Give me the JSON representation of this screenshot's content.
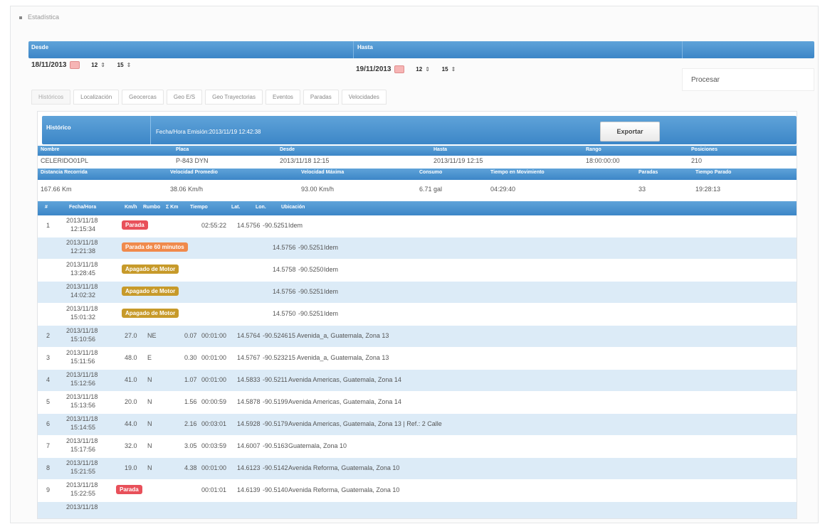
{
  "section_title": "Estadística",
  "range": {
    "desde_label": "Desde",
    "hasta_label": "Hasta",
    "desde_date": "18/11/2013",
    "desde_hour": "12",
    "desde_min": "15",
    "hasta_date": "19/11/2013",
    "hasta_hour": "12",
    "hasta_min": "15",
    "procesar_label": "Procesar"
  },
  "tabs": [
    "Históricos",
    "Localización",
    "Geocercas",
    "Geo E/S",
    "Geo Trayectorias",
    "Eventos",
    "Paradas",
    "Velocidades"
  ],
  "report": {
    "title": "Histórico",
    "generated": "Fecha/Hora Emisión:2013/11/19 12:42:38",
    "export_label": "Exportar",
    "h1": {
      "nombre": "Nombre",
      "placa": "Placa",
      "desde": "Desde",
      "hasta": "Hasta",
      "rango": "Rango",
      "posiciones": "Posiciones"
    },
    "v1": {
      "nombre": "CELERIDO01PL",
      "placa": "P-843 DYN",
      "desde": "2013/11/18 12:15",
      "hasta": "2013/11/19 12:15",
      "rango": "18:00:00:00",
      "posiciones": "210"
    },
    "h2": {
      "distancia": "Distancia Recorrida",
      "vel_prom": "Velocidad Promedio",
      "vel_max": "Velocidad Máxima",
      "consumo": "Consumo",
      "t_mov": "Tiempo en Movimiento",
      "paradas": "Paradas",
      "t_parado": "Tiempo Parado"
    },
    "v2": {
      "distancia": "167.66 Km",
      "vel_prom": "38.06 Km/h",
      "vel_max": "93.00 Km/h",
      "consumo": "6.71 gal",
      "t_mov": "04:29:40",
      "paradas": "33",
      "t_parado": "19:28:13"
    }
  },
  "columns": [
    "#",
    "Fecha/Hora",
    "Km/h",
    "Rumbo",
    "Σ Km",
    "Tiempo",
    "Lat.",
    "Lon.",
    "Ubicación"
  ],
  "rows": [
    {
      "n": "1",
      "date": "2013/11/18",
      "time": "12:15:34",
      "badge": "Parada",
      "km": "",
      "rumbo": "",
      "sum": "",
      "tiempo": "02:55:22",
      "lat": "14.5756",
      "lon": "-90.5251",
      "ubic": "Idem"
    },
    {
      "n": "",
      "date": "2013/11/18",
      "time": "12:21:38",
      "badge": "Parada de 60 minutos",
      "km": "",
      "rumbo": "",
      "sum": "",
      "tiempo": "",
      "lat": "14.5756",
      "lon": "-90.5251",
      "ubic": "Idem"
    },
    {
      "n": "",
      "date": "2013/11/18",
      "time": "13:28:45",
      "badge": "Apagado de Motor",
      "km": "",
      "rumbo": "",
      "sum": "",
      "tiempo": "",
      "lat": "14.5758",
      "lon": "-90.5250",
      "ubic": "Idem"
    },
    {
      "n": "",
      "date": "2013/11/18",
      "time": "14:02:32",
      "badge": "Apagado de Motor",
      "km": "",
      "rumbo": "",
      "sum": "",
      "tiempo": "",
      "lat": "14.5756",
      "lon": "-90.5251",
      "ubic": "Idem"
    },
    {
      "n": "",
      "date": "2013/11/18",
      "time": "15:01:32",
      "badge": "Apagado de Motor",
      "km": "",
      "rumbo": "",
      "sum": "",
      "tiempo": "",
      "lat": "14.5750",
      "lon": "-90.5251",
      "ubic": "Idem"
    },
    {
      "n": "2",
      "date": "2013/11/18",
      "time": "15:10:56",
      "badge": "",
      "km": "27.0",
      "rumbo": "NE",
      "sum": "0.07",
      "tiempo": "00:01:00",
      "lat": "14.5764",
      "lon": "-90.5246",
      "ubic": "15 Avenida_a, Guatemala, Zona 13"
    },
    {
      "n": "3",
      "date": "2013/11/18",
      "time": "15:11:56",
      "badge": "",
      "km": "48.0",
      "rumbo": "E",
      "sum": "0.30",
      "tiempo": "00:01:00",
      "lat": "14.5767",
      "lon": "-90.5232",
      "ubic": "15 Avenida_a, Guatemala, Zona 13"
    },
    {
      "n": "4",
      "date": "2013/11/18",
      "time": "15:12:56",
      "badge": "",
      "km": "41.0",
      "rumbo": "N",
      "sum": "1.07",
      "tiempo": "00:01:00",
      "lat": "14.5833",
      "lon": "-90.5211",
      "ubic": "Avenida Americas, Guatemala, Zona 14"
    },
    {
      "n": "5",
      "date": "2013/11/18",
      "time": "15:13:56",
      "badge": "",
      "km": "20.0",
      "rumbo": "N",
      "sum": "1.56",
      "tiempo": "00:00:59",
      "lat": "14.5878",
      "lon": "-90.5199",
      "ubic": "Avenida Americas, Guatemala, Zona 14"
    },
    {
      "n": "6",
      "date": "2013/11/18",
      "time": "15:14:55",
      "badge": "",
      "km": "44.0",
      "rumbo": "N",
      "sum": "2.16",
      "tiempo": "00:03:01",
      "lat": "14.5928",
      "lon": "-90.5179",
      "ubic": "Avenida Americas, Guatemala, Zona 13 | Ref.: 2 Calle"
    },
    {
      "n": "7",
      "date": "2013/11/18",
      "time": "15:17:56",
      "badge": "",
      "km": "32.0",
      "rumbo": "N",
      "sum": "3.05",
      "tiempo": "00:03:59",
      "lat": "14.6007",
      "lon": "-90.5163",
      "ubic": "Guatemala, Zona 10"
    },
    {
      "n": "8",
      "date": "2013/11/18",
      "time": "15:21:55",
      "badge": "",
      "km": "19.0",
      "rumbo": "N",
      "sum": "4.38",
      "tiempo": "00:01:00",
      "lat": "14.6123",
      "lon": "-90.5142",
      "ubic": "Avenida Reforma, Guatemala, Zona 10"
    },
    {
      "n": "9",
      "date": "2013/11/18",
      "time": "15:22:55",
      "badge": "Parada",
      "km": "",
      "rumbo": "",
      "sum": "",
      "tiempo": "00:01:01",
      "lat": "14.6139",
      "lon": "-90.5140",
      "ubic": "Avenida Reforma, Guatemala, Zona 10"
    },
    {
      "n": "",
      "date": "2013/11/18",
      "time": "",
      "badge": "",
      "km": "",
      "rumbo": "",
      "sum": "",
      "tiempo": "",
      "lat": "",
      "lon": "",
      "ubic": ""
    }
  ],
  "badge_colors": {
    "Parada": "#e8505a",
    "Parada de 60 minutos": "#f08a4c",
    "Apagado de Motor": "#c79a2a"
  }
}
